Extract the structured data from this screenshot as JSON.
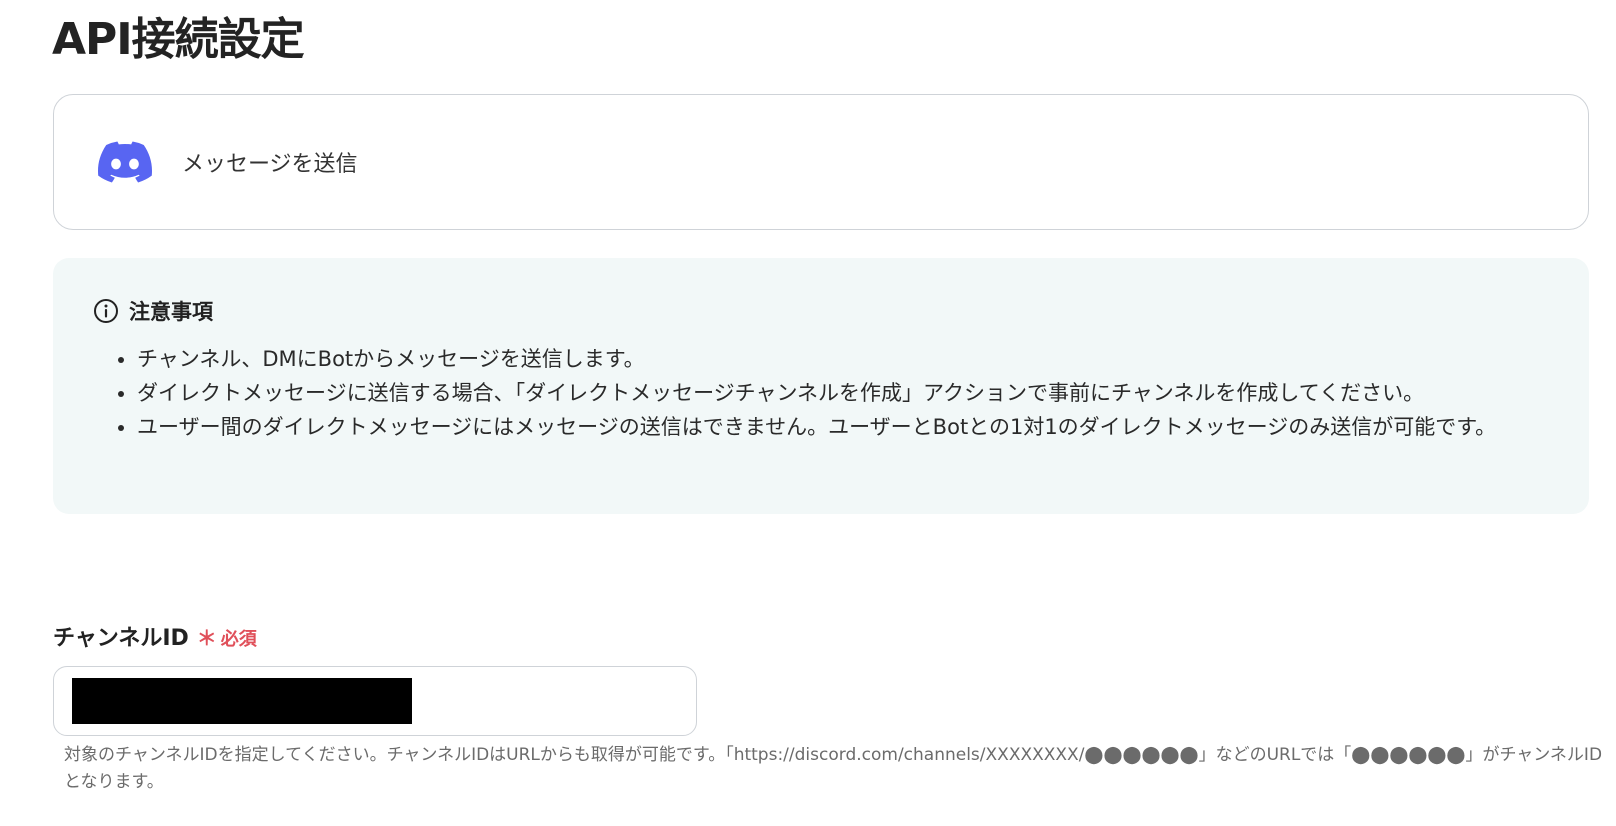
{
  "page": {
    "title": "API接続設定"
  },
  "action": {
    "icon": "discord-icon",
    "label": "メッセージを送信",
    "brand_color": "#5865F2"
  },
  "notice": {
    "icon": "info-icon",
    "title": "注意事項",
    "items": [
      "チャンネル、DMにBotからメッセージを送信します。",
      "ダイレクトメッセージに送信する場合、「ダイレクトメッセージチャンネルを作成」アクションで事前にチャンネルを作成してください。",
      "ユーザー間のダイレクトメッセージにはメッセージの送信はできません。ユーザーとBotとの1対1のダイレクトメッセージのみ送信が可能です。"
    ],
    "background_color": "#F2F8F8"
  },
  "field": {
    "label": "チャンネルID",
    "required_mark": "＊",
    "required_text": "必須",
    "required_color": "#E0505A",
    "value_redacted": true,
    "help_text": "対象のチャンネルIDを指定してください。チャンネルIDはURLからも取得が可能です。「https://discord.com/channels/XXXXXXXX/⬤⬤⬤⬤⬤⬤」などのURLでは「⬤⬤⬤⬤⬤⬤」がチャンネルIDとなります。"
  }
}
